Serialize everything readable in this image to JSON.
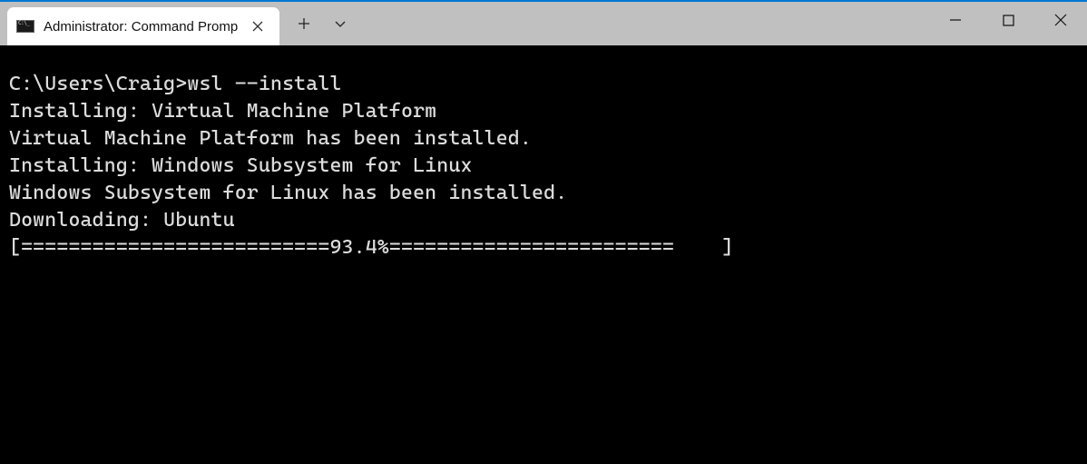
{
  "accent_color": "#0078d4",
  "tab": {
    "title": "Administrator: Command Promp",
    "icon": "cmd-icon"
  },
  "terminal": {
    "prompt": "C:\\Users\\Craig>",
    "command": "wsl --install",
    "lines": [
      "Installing: Virtual Machine Platform",
      "Virtual Machine Platform has been installed.",
      "Installing: Windows Subsystem for Linux",
      "Windows Subsystem for Linux has been installed.",
      "Downloading: Ubuntu"
    ],
    "progress": {
      "percent": 93.4,
      "bar_text": "[==========================93.4%========================    ]"
    }
  }
}
